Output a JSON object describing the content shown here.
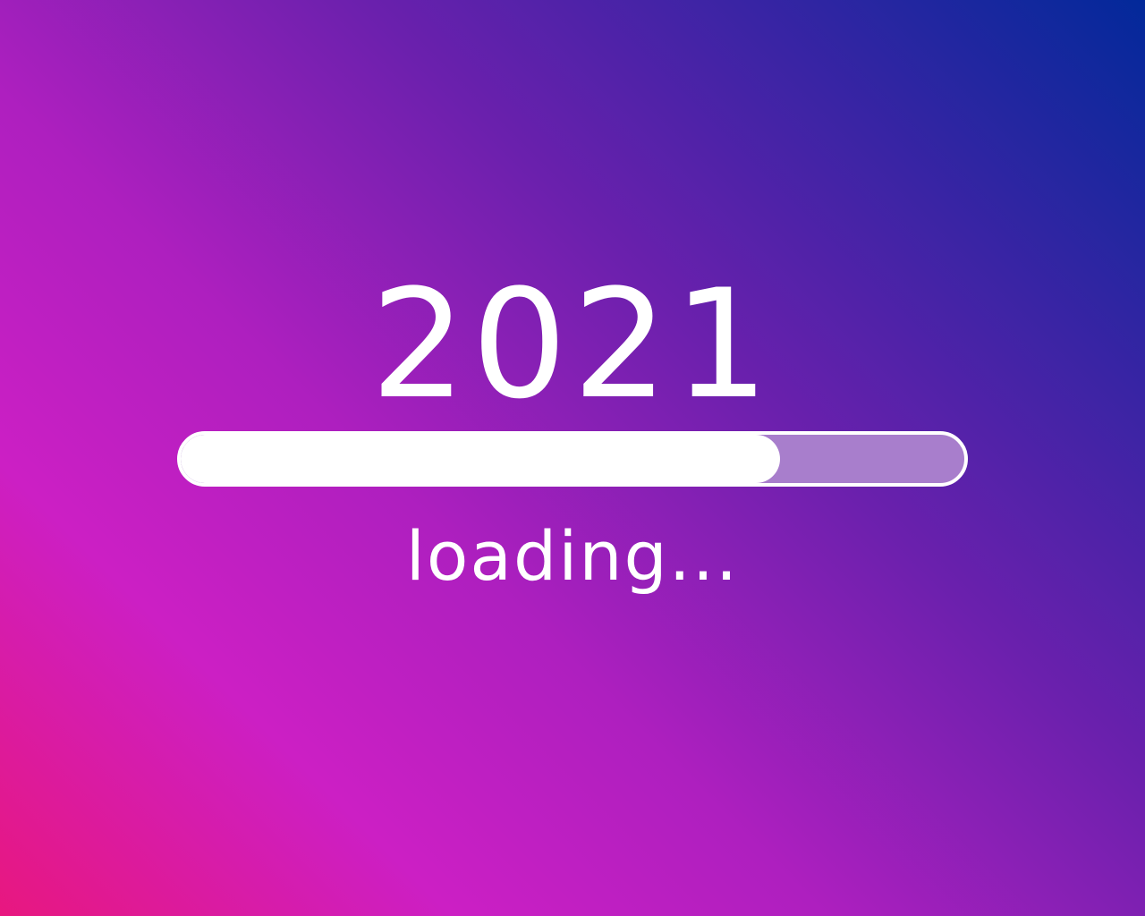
{
  "splash": {
    "year": "2021",
    "loading_label": "loading...",
    "progress": 0.765
  },
  "colors": {
    "gradient_start": "#e8177f",
    "gradient_mid": "#cc1fc4",
    "gradient_end": "#02299a",
    "track_color": "#a87ecc",
    "fill_color": "#ffffff",
    "text_color": "#ffffff"
  }
}
